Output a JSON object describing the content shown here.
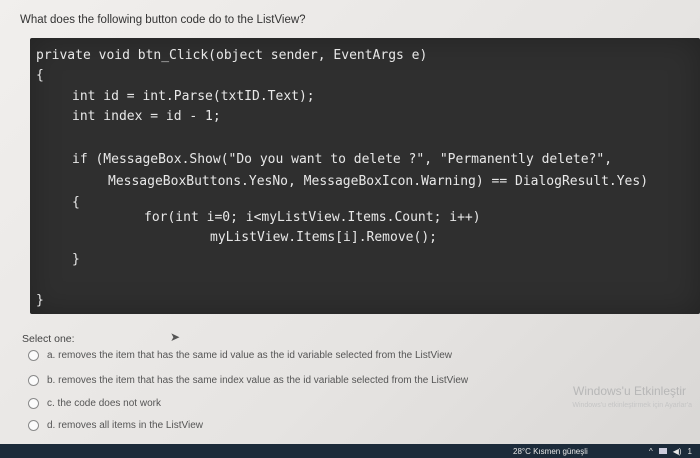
{
  "question": "What does the following button code do to the ListView?",
  "code": {
    "line1": "private void btn_Click(object sender, EventArgs e)",
    "line2": "{",
    "line3": "int id = int.Parse(txtID.Text);",
    "line4": "int index = id - 1;",
    "line5": "if (MessageBox.Show(\"Do you want to delete ?\", \"Permanently delete?\",",
    "line6": "MessageBoxButtons.YesNo, MessageBoxIcon.Warning) == DialogResult.Yes)",
    "line7": "{",
    "line8": "for(int i=0; i<myListView.Items.Count; i++)",
    "line9": "myListView.Items[i].Remove();",
    "line10": "}",
    "line11": "}"
  },
  "select_one": "Select one:",
  "options": [
    {
      "label": "a. removes the item that has the same id value as the id variable selected from the ListView"
    },
    {
      "label": "b. removes the item that has the same index value as the id variable selected from the ListView"
    },
    {
      "label": "c. the code does not work"
    },
    {
      "label": "d. removes all items in the ListView"
    }
  ],
  "watermark": {
    "title": "Windows'u Etkinleştir",
    "subtitle": "Windows'u etkinleştirmek için Ayarlar'a"
  },
  "taskbar": {
    "weather": "28°C  Kısmen güneşli",
    "tray_text": "1"
  }
}
